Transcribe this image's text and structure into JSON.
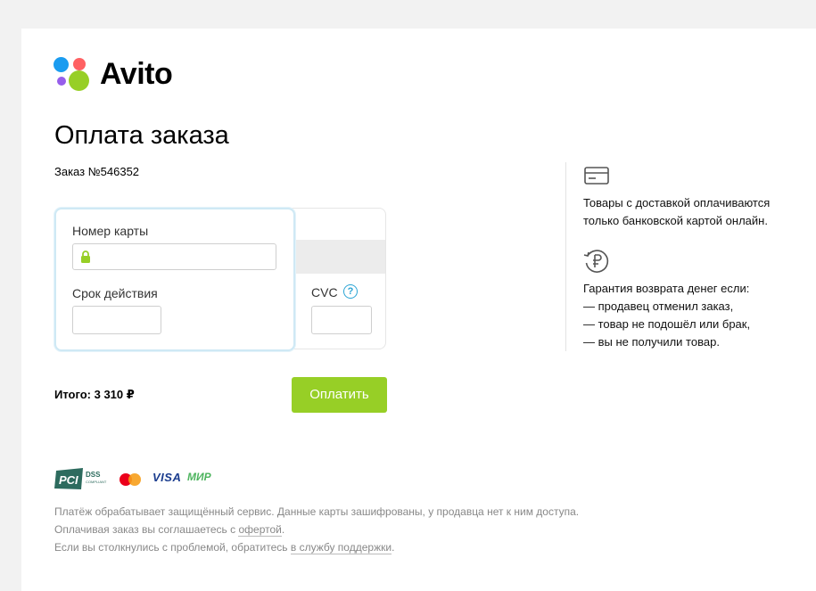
{
  "brand": {
    "name": "Avito",
    "dot_colors": [
      "#1a9cf0",
      "#ff6163",
      "#965eeb",
      "#97cf26"
    ]
  },
  "page": {
    "title": "Оплата заказа",
    "order_number": "Заказ №546352"
  },
  "card_form": {
    "card_number_label": "Номер карты",
    "card_number_value": "",
    "expiry_label": "Срок действия",
    "expiry_value": "",
    "cvc_label": "CVC",
    "cvc_help": "?",
    "cvc_value": ""
  },
  "summary": {
    "total": "Итого: 3 310 ₽",
    "pay_button": "Оплатить"
  },
  "info": {
    "delivery_line1": "Товары с доставкой оплачиваются",
    "delivery_line2": "только банковской картой онлайн.",
    "guarantee_title": "Гарантия возврата денег если:",
    "guarantee_items": [
      "— продавец отменил заказ,",
      "— товар не подошёл или брак,",
      "— вы не получили товар."
    ]
  },
  "payment_logos": {
    "pci": "PCI",
    "pci_dss": "DSS",
    "pci_compliant": "COMPLIANT",
    "visa": "VISA",
    "mir": "МИР"
  },
  "footer": {
    "line1": "Платёж обрабатывает защищённый сервис. Данные карты зашифрованы, у продавца нет к ним доступа.",
    "line2_text": "Оплачивая заказ вы соглашаетесь с ",
    "line2_link": "офертой",
    "line2_end": ".",
    "line3_text": "Если вы столкнулись с проблемой, обратитесь ",
    "line3_link": "в службу поддержки",
    "line3_end": "."
  }
}
